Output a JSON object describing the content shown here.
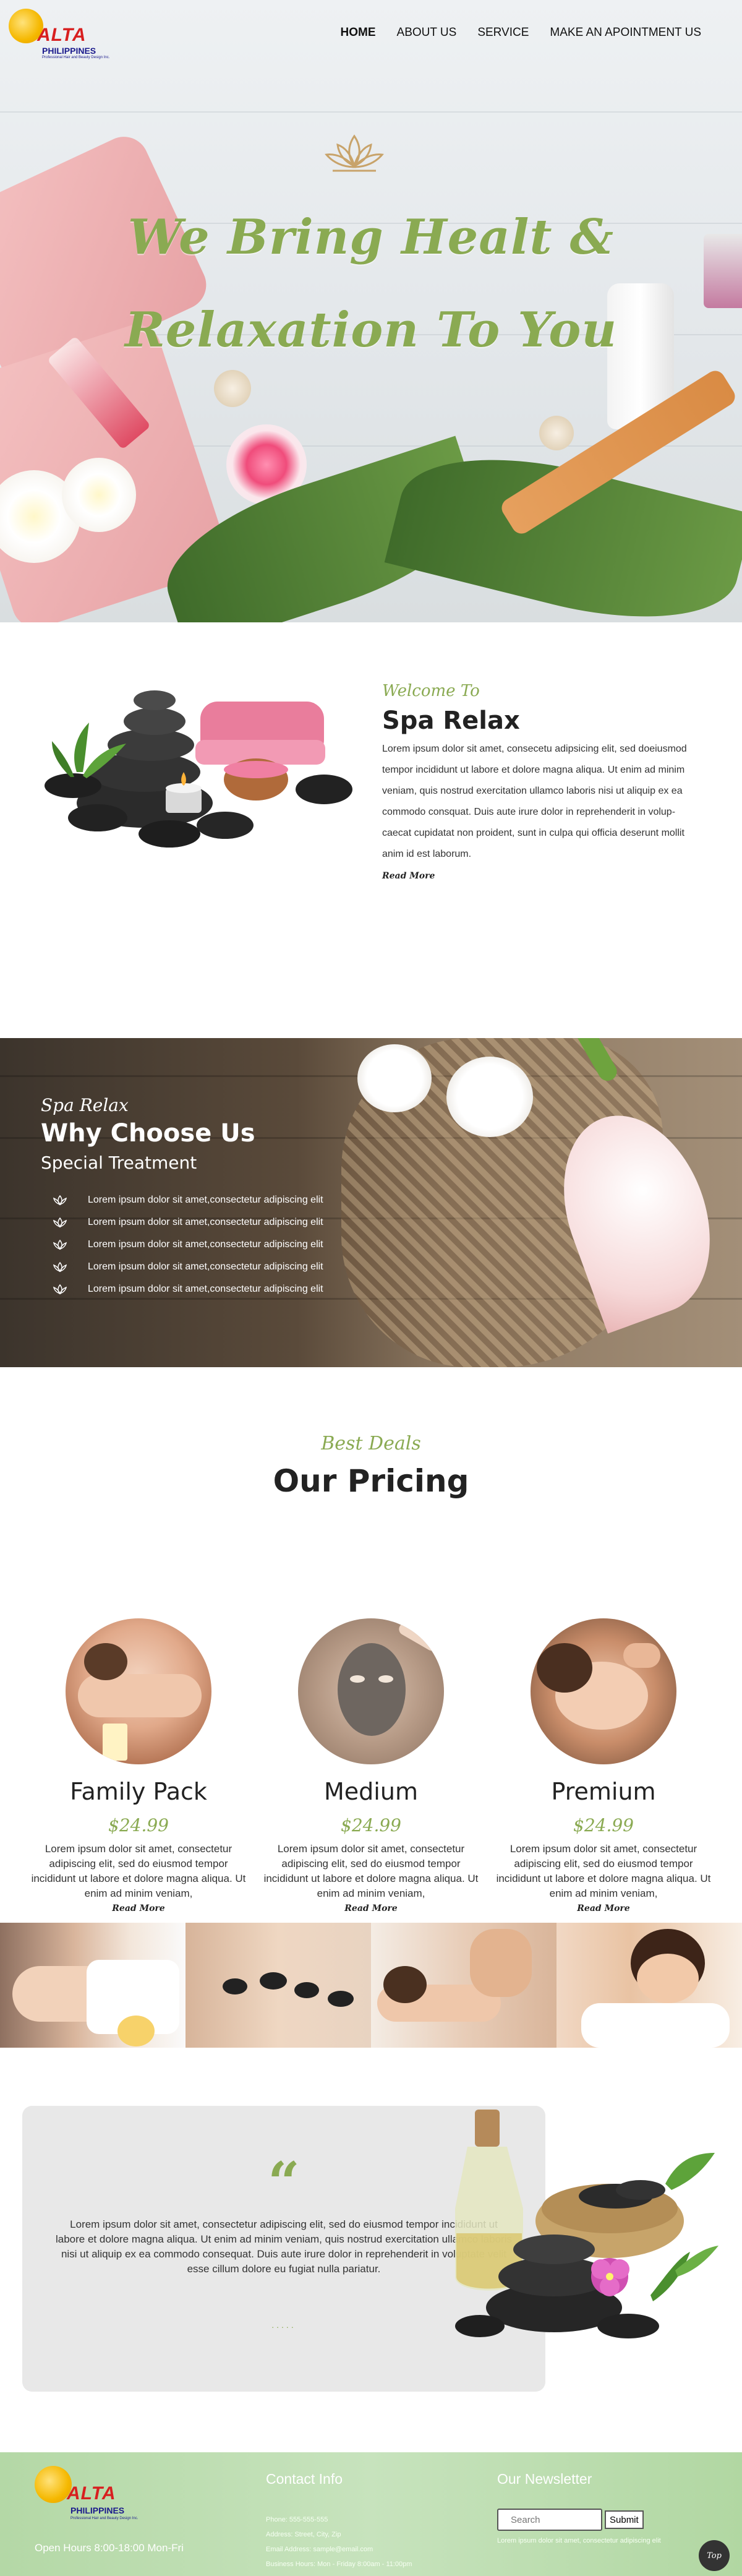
{
  "brand": {
    "name": "ALTA",
    "country": "PHILIPPINES",
    "tagline": "Professional Hair and Beauty Design Inc."
  },
  "nav": {
    "items": [
      "HOME",
      "ABOUT US",
      "SERVICE",
      "MAKE AN APOINTMENT US"
    ],
    "active": "HOME"
  },
  "hero": {
    "title_line1": "We Bring Healt &",
    "title_line2": "Relaxation To You"
  },
  "welcome": {
    "kicker": "Welcome To",
    "title": "Spa Relax",
    "paragraphs": [
      "Lorem ipsum dolor sit amet, consecetu adipsicing elit, sed doeiusmod",
      "tempor incididunt ut labore et dolore magna aliqua. Ut enim ad minim",
      "veniam, quis nostrud exercitation ullamco laboris nisi ut aliquip ex ea",
      "commodo consquat. Duis aute irure dolor in reprehenderit in volup-",
      "caecat cupidatat non proident, sunt in culpa qui officia deserunt mollit",
      "anim id est laborum."
    ],
    "read_more": "Read More"
  },
  "why": {
    "kicker": "Spa Relax",
    "title": "Why Choose Us",
    "subtitle": "Special Treatment",
    "items": [
      "Lorem ipsum dolor sit amet,consectetur adipiscing elit",
      "Lorem ipsum dolor sit amet,consectetur adipiscing elit",
      "Lorem ipsum dolor sit amet,consectetur adipiscing elit",
      "Lorem ipsum dolor sit amet,consectetur adipiscing elit",
      "Lorem ipsum dolor sit amet,consectetur adipiscing elit"
    ]
  },
  "pricing": {
    "kicker": "Best Deals",
    "title": "Our Pricing",
    "plans": [
      {
        "name": "Family Pack",
        "price": "$24.99",
        "desc": "Lorem ipsum dolor sit amet, consectetur adipiscing elit, sed do eiusmod tempor incididunt ut labore et dolore magna aliqua. Ut enim ad minim veniam,",
        "read_more": "Read More"
      },
      {
        "name": "Medium",
        "price": "$24.99",
        "desc": "Lorem ipsum dolor sit amet, consectetur adipiscing elit, sed do eiusmod tempor incididunt ut labore et dolore magna aliqua. Ut enim ad minim veniam,",
        "read_more": "Read More"
      },
      {
        "name": "Premium",
        "price": "$24.99",
        "desc": "Lorem ipsum dolor sit amet, consectetur adipiscing elit, sed do eiusmod tempor incididunt ut labore et dolore magna aliqua. Ut enim ad minim veniam,",
        "read_more": "Read More"
      }
    ]
  },
  "testimonial": {
    "quote_mark": "“",
    "text": "Lorem ipsum dolor sit amet, consectetur adipiscing elit, sed do eiusmod tempor incididunt ut labore et dolore magna aliqua. Ut enim ad minim veniam, quis nostrud exercitation ullamco laboris nisi ut aliquip ex ea commodo consequat. Duis aute irure dolor in reprehenderit in voluptate velit esse cillum dolore eu fugiat nulla pariatur.",
    "dots": "....."
  },
  "footer": {
    "hours": "Open Hours 8:00-18:00 Mon-Fri",
    "contact_title": "Contact Info",
    "contact_lines": [
      "Phone: 555-555-555",
      "Address: Street, City, Zip",
      "Email Address: sample@email.com",
      "Business Hours: Mon - Friday 8:00am - 11:00pm"
    ],
    "newsletter_title": "Our Newsletter",
    "search_placeholder": "Search",
    "submit_label": "Submit",
    "newsletter_note": "Lorem ipsum dolor sit amet, consectetur adipiscing elit",
    "top_label": "Top"
  },
  "colors": {
    "accent_green": "#8aaa52",
    "footer_green": "#b4d8a6",
    "logo_red": "#d81f1f",
    "logo_blue": "#1a1a8c"
  }
}
